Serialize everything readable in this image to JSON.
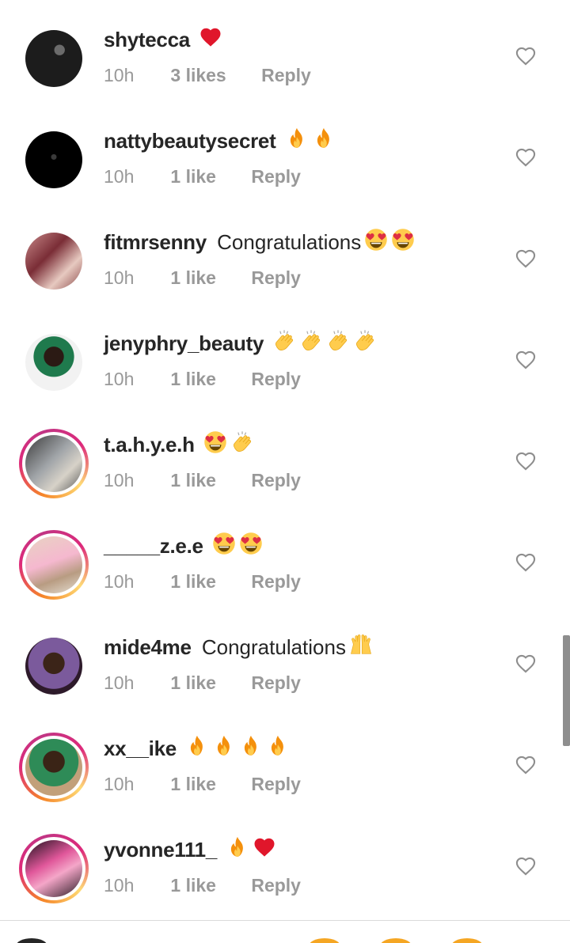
{
  "reply_label": "Reply",
  "comments": [
    {
      "username": "shytecca",
      "text": "",
      "emojis": [
        "heart"
      ],
      "time": "10h",
      "likes": "3 likes",
      "story_ring": false
    },
    {
      "username": "nattybeautysecret",
      "text": "",
      "emojis": [
        "fire",
        "fire"
      ],
      "time": "10h",
      "likes": "1 like",
      "story_ring": false
    },
    {
      "username": "fitmrsenny",
      "text": "Congratulations",
      "emojis": [
        "heart-eyes",
        "heart-eyes"
      ],
      "time": "10h",
      "likes": "1 like",
      "story_ring": false
    },
    {
      "username": "jenyphry_beauty",
      "text": "",
      "emojis": [
        "clap",
        "clap",
        "clap",
        "clap"
      ],
      "time": "10h",
      "likes": "1 like",
      "story_ring": false
    },
    {
      "username": "t.a.h.y.e.h",
      "text": "",
      "emojis": [
        "heart-eyes",
        "clap"
      ],
      "time": "10h",
      "likes": "1 like",
      "story_ring": true
    },
    {
      "username": "_____z.e.e",
      "text": "",
      "emojis": [
        "heart-eyes",
        "heart-eyes"
      ],
      "time": "10h",
      "likes": "1 like",
      "story_ring": true
    },
    {
      "username": "mide4me",
      "text": "Congratulations",
      "emojis": [
        "raised-hands"
      ],
      "time": "10h",
      "likes": "1 like",
      "story_ring": false
    },
    {
      "username": "xx__ike",
      "text": "",
      "emojis": [
        "fire",
        "fire",
        "fire",
        "fire"
      ],
      "time": "10h",
      "likes": "1 like",
      "story_ring": true
    },
    {
      "username": "yvonne111_",
      "text": "",
      "emojis": [
        "fire",
        "heart"
      ],
      "time": "10h",
      "likes": "1 like",
      "story_ring": true
    }
  ],
  "colors": {
    "text": "#262626",
    "meta": "#999999",
    "heart_outline": "#8e8e8e",
    "ring_start": "#f58529",
    "ring_end": "#dd2a7b"
  }
}
